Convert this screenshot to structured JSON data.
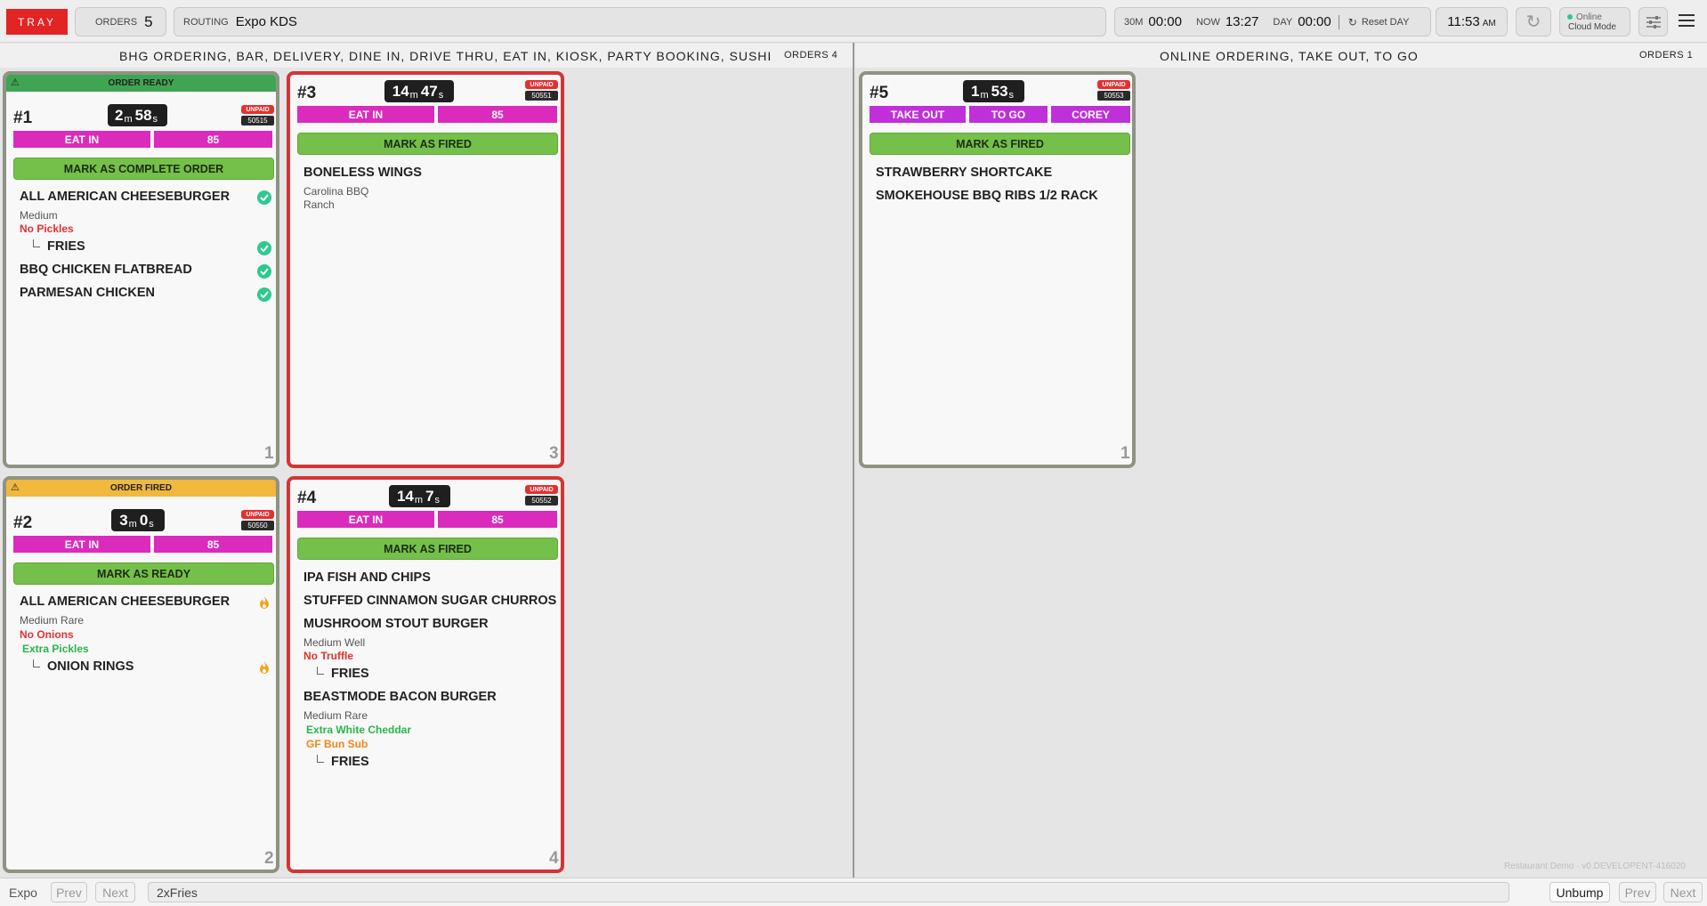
{
  "topbar": {
    "logo": "TRAY",
    "orders_label": "ORDERS",
    "orders_count": "5",
    "routing_label": "ROUTING",
    "routing_value": "Expo KDS",
    "t30m_label": "30M",
    "t30m_value": "00:00",
    "now_label": "NOW",
    "now_value": "13:27",
    "day_label": "DAY",
    "day_value": "00:00",
    "reset_label": "Reset DAY",
    "clock": "11:53",
    "clock_ampm": "AM",
    "status_online": "Online",
    "status_mode": "Cloud Mode"
  },
  "columns": [
    {
      "title": "BHG ORDERING, BAR, DELIVERY, DINE IN, DRIVE THRU, EAT IN, KIOSK, PARTY BOOKING, SUSHI",
      "orders": "ORDERS 4"
    },
    {
      "title": "ONLINE ORDERING, TAKE OUT, TO GO",
      "orders": "ORDERS 1"
    }
  ],
  "cards": {
    "c1": {
      "banner": "ORDER READY",
      "number": "#1",
      "timer_m": "2",
      "timer_s": "58",
      "unpaid": "UNPAID",
      "ticket": "50515",
      "tags": [
        "EAT IN",
        "85"
      ],
      "action": "MARK AS COMPLETE ORDER",
      "items": [
        "ALL AMERICAN CHEESEBURGER",
        "BBQ CHICKEN FLATBREAD",
        "PARMESAN CHICKEN"
      ],
      "mods": [
        "Medium",
        "No Pickles"
      ],
      "sub": "FRIES",
      "count": "1"
    },
    "c2": {
      "banner": "ORDER FIRED",
      "number": "#2",
      "timer_m": "3",
      "timer_s": "0",
      "unpaid": "UNPAID",
      "ticket": "50550",
      "tags": [
        "EAT IN",
        "85"
      ],
      "action": "MARK AS READY",
      "items": [
        "ALL AMERICAN CHEESEBURGER"
      ],
      "mods": [
        "Medium Rare",
        "No Onions",
        "Extra Pickles"
      ],
      "sub": "ONION RINGS",
      "count": "2"
    },
    "c3": {
      "number": "#3",
      "timer_m": "14",
      "timer_s": "47",
      "unpaid": "UNPAID",
      "ticket": "50551",
      "tags": [
        "EAT IN",
        "85"
      ],
      "action": "MARK AS FIRED",
      "items": [
        "BONELESS WINGS"
      ],
      "mods": [
        "Carolina BBQ",
        "Ranch"
      ],
      "count": "3"
    },
    "c4": {
      "number": "#4",
      "timer_m": "14",
      "timer_s": "7",
      "unpaid": "UNPAID",
      "ticket": "50552",
      "tags": [
        "EAT IN",
        "85"
      ],
      "action": "MARK AS FIRED",
      "items": [
        "IPA FISH AND CHIPS",
        "STUFFED CINNAMON SUGAR CHURROS",
        "MUSHROOM STOUT BURGER",
        "BEASTMODE BACON BURGER"
      ],
      "mods": [
        "Medium Well",
        "No Truffle",
        "Medium Rare",
        "Extra White Cheddar",
        "GF Bun Sub"
      ],
      "subs": [
        "FRIES",
        "FRIES"
      ],
      "count": "4"
    },
    "c5": {
      "number": "#5",
      "timer_m": "1",
      "timer_s": "53",
      "unpaid": "UNPAID",
      "ticket": "50553",
      "tags": [
        "TAKE OUT",
        "TO GO",
        "COREY"
      ],
      "action": "MARK AS FIRED",
      "items": [
        "STRAWBERRY SHORTCAKE",
        "SMOKEHOUSE BBQ RIBS 1/2 RACK"
      ],
      "count": "1"
    }
  },
  "units": {
    "m": "m",
    "s": "s"
  },
  "footer_version": "Restaurant Demo · v0.DEVELOPENT-416020",
  "bottombar": {
    "expo": "Expo",
    "prev": "Prev",
    "next": "Next",
    "search_value": "2xFries",
    "unbump": "Unbump",
    "prev2": "Prev",
    "next2": "Next"
  },
  "colors": {
    "ready": "#3fa553",
    "fired": "#f0b83c",
    "red_border": "#d63434",
    "grey_border": "#8e9384",
    "tag": "#da2bbd",
    "tag_purple": "#c030d8",
    "green_btn": "#74c04a",
    "check": "#2ec98f"
  }
}
